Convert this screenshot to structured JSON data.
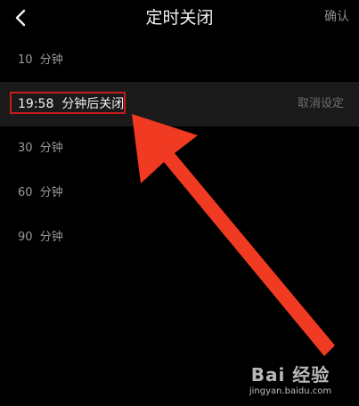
{
  "header": {
    "title": "定时关闭",
    "confirm_label": "确认",
    "back_icon": "chevron-left-icon"
  },
  "options": [
    {
      "label": "10  分钟",
      "selected": false
    },
    {
      "label": "19:58  分钟后关闭",
      "selected": true,
      "cancel_label": "取消设定"
    },
    {
      "label": "30  分钟",
      "selected": false
    },
    {
      "label": "60  分钟",
      "selected": false
    },
    {
      "label": "90  分钟",
      "selected": false
    }
  ],
  "annotation": {
    "highlight_color": "#c81c1c",
    "arrow_color": "#f03a22"
  },
  "watermark": {
    "logo": "Bai 经验",
    "url": "jingyan.baidu.com"
  }
}
